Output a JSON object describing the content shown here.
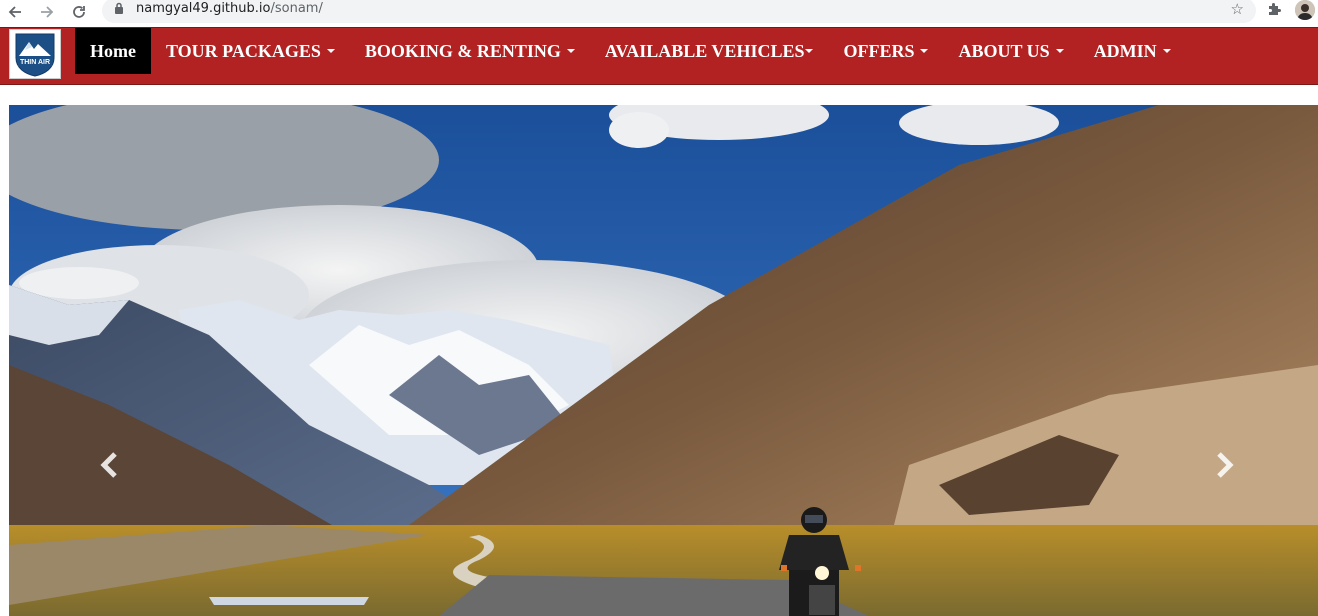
{
  "browser": {
    "url_host": "namgyal49.github.io",
    "url_path": "/sonam/",
    "back_icon": "arrow-left-icon",
    "forward_icon": "arrow-right-icon",
    "reload_icon": "reload-icon",
    "lock_icon": "lock-icon",
    "bookmark_icon": "star-icon",
    "extensions_icon": "puzzle-icon"
  },
  "logo": {
    "text": "THIN AIR"
  },
  "navbar": {
    "color": "#b22222",
    "items": [
      {
        "label": "Home",
        "active": true
      },
      {
        "label": "TOUR PACKAGES"
      },
      {
        "label": "BOOKING & RENTING"
      },
      {
        "label": "AVAILABLE VEHICLES"
      },
      {
        "label": "OFFERS"
      },
      {
        "label": "ABOUT US"
      },
      {
        "label": "ADMIN"
      }
    ]
  },
  "carousel": {
    "prev_icon": "chevron-left-icon",
    "next_icon": "chevron-right-icon"
  }
}
